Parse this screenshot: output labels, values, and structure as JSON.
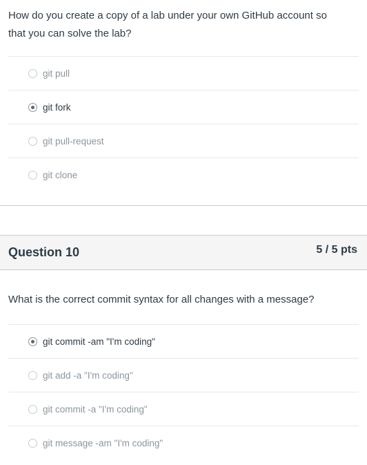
{
  "question9": {
    "text": "How do you create a copy of a lab under your own GitHub account so that you can solve the lab?",
    "answers": [
      {
        "label": "git pull",
        "selected": false
      },
      {
        "label": "git fork",
        "selected": true
      },
      {
        "label": "git pull-request",
        "selected": false
      },
      {
        "label": "git clone",
        "selected": false
      }
    ]
  },
  "question10": {
    "title": "Question 10",
    "points": "5 / 5 pts",
    "text": "What is the correct commit syntax for all changes with a message?",
    "answers": [
      {
        "label": "git commit -am \"I'm coding\"",
        "selected": true
      },
      {
        "label": "git add -a \"I'm coding\"",
        "selected": false
      },
      {
        "label": "git commit -a \"I'm coding\"",
        "selected": false
      },
      {
        "label": "git message -am \"I'm coding\"",
        "selected": false
      }
    ]
  }
}
